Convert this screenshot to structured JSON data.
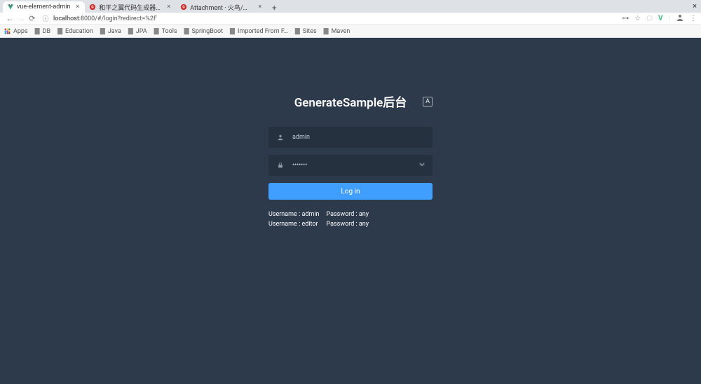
{
  "tabs": [
    {
      "title": "vue-element-admin"
    },
    {
      "title": "和平之翼代码生成器SME…"
    },
    {
      "title": "Attachment · 火鸟/和平之…"
    }
  ],
  "url": {
    "host": "localhost",
    "port_path": ":8000/#/login?redirect=%2F"
  },
  "bookmarks": [
    {
      "label": "Apps"
    },
    {
      "label": "DB"
    },
    {
      "label": "Education"
    },
    {
      "label": "Java"
    },
    {
      "label": "JPA"
    },
    {
      "label": "Tools"
    },
    {
      "label": "SpringBoot"
    },
    {
      "label": "Imported From F…"
    },
    {
      "label": "Sites"
    },
    {
      "label": "Maven"
    }
  ],
  "login": {
    "title": "GenerateSample后台",
    "username_value": "admin",
    "password_value": "•••••••",
    "button_label": "Log in",
    "tips": {
      "admin_user": "Username : admin",
      "admin_pass": "Password : any",
      "editor_user": "Username : editor",
      "editor_pass": "Password : any"
    }
  }
}
